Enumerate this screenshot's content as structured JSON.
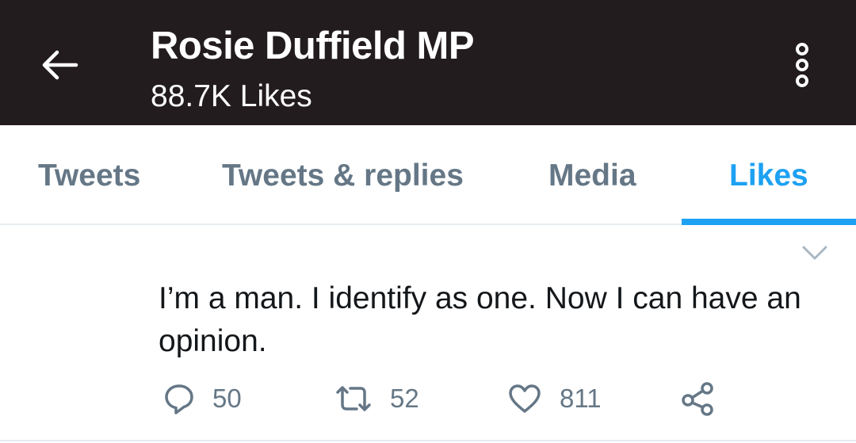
{
  "header": {
    "title": "Rosie Duffield MP",
    "subtitle": "88.7K Likes",
    "back_icon": "arrow-left-icon",
    "more_icon": "more-vertical-icon",
    "background": "#231c1e"
  },
  "tabs": [
    {
      "label": "Tweets",
      "active": false
    },
    {
      "label": "Tweets & replies",
      "active": false
    },
    {
      "label": "Media",
      "active": false
    },
    {
      "label": "Likes",
      "active": true
    }
  ],
  "tweet": {
    "text": "I’m a man. I identify as one. Now I can have an opinion.",
    "actions": {
      "reply": {
        "icon": "reply-icon",
        "count": "50"
      },
      "retweet": {
        "icon": "retweet-icon",
        "count": "52"
      },
      "like": {
        "icon": "heart-icon",
        "count": "811"
      },
      "share": {
        "icon": "share-icon"
      }
    }
  },
  "colors": {
    "accent": "#1da1f2",
    "muted": "#657786",
    "text": "#14171a"
  }
}
